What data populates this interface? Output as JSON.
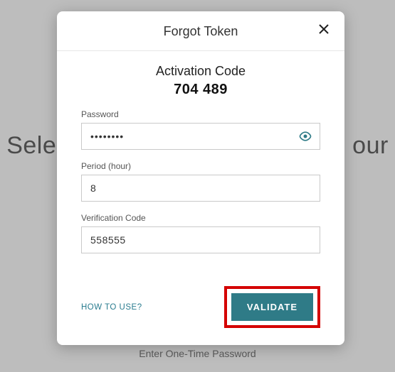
{
  "background": {
    "heading_left": "Sele",
    "heading_right": "our",
    "subtext": "Enter One-Time Password"
  },
  "modal": {
    "title": "Forgot Token",
    "activation_label": "Activation Code",
    "activation_code": "704 489",
    "fields": {
      "password": {
        "label": "Password",
        "value": "••••••••"
      },
      "period": {
        "label": "Period (hour)",
        "value": "8"
      },
      "verify": {
        "label": "Verification Code",
        "value": "558555"
      }
    },
    "howto": "HOW TO USE?",
    "validate": "VALIDATE"
  },
  "colors": {
    "accent": "#2f7b87",
    "highlight_border": "#d40000"
  }
}
